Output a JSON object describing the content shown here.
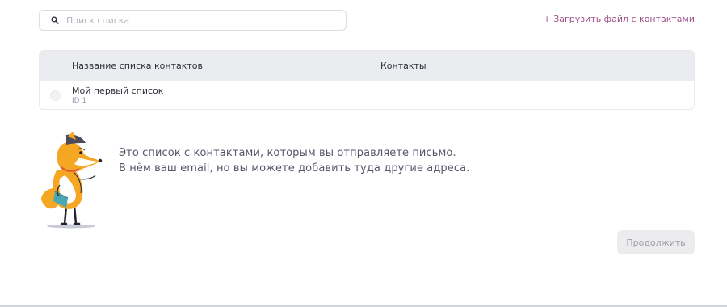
{
  "search": {
    "placeholder": "Поиск списка"
  },
  "upload_link": "+ Загрузить файл с контактами",
  "table": {
    "columns": [
      "Название списка контактов",
      "Контакты"
    ],
    "rows": [
      {
        "title": "Мой первый список",
        "id": "ID 1",
        "contacts": ""
      }
    ]
  },
  "message": {
    "line1": "Это список с контактами, которым вы отправляете письмо.",
    "line2": "В нём ваш email, но вы можете добавить туда другие адреса."
  },
  "continue_button": "Продолжить",
  "colors": {
    "link": "#a0518a",
    "header_bg": "#ebecef",
    "button_disabled_bg": "#ececef",
    "fox_orange": "#f5a623"
  },
  "icons": [
    "search-icon",
    "fox-illustration"
  ]
}
